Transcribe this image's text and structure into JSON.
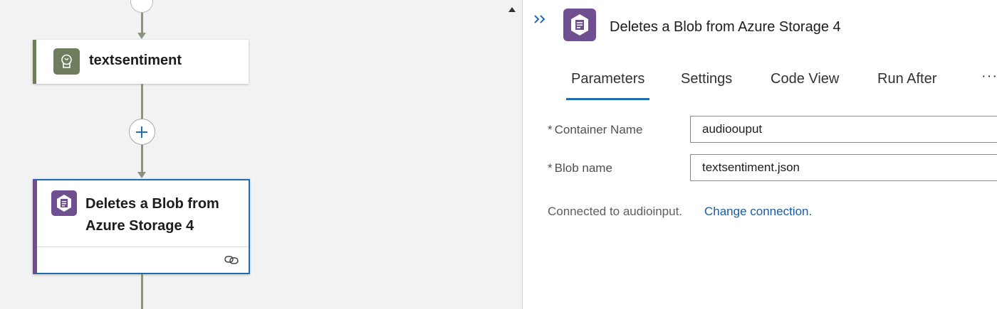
{
  "canvas": {
    "nodes": [
      {
        "title": "textsentiment",
        "icon": "brain-icon",
        "accent": "#6f7d5f"
      },
      {
        "title": "Deletes a Blob from Azure Storage 4",
        "icon": "blob-storage-icon",
        "accent": "#6f4f8f"
      }
    ],
    "add_step_icon": "plus-icon",
    "node_footer_icon": "link-icon"
  },
  "panel": {
    "title": "Deletes a Blob from Azure Storage 4",
    "collapse_icon": "chevrons-right-icon",
    "tabs": [
      {
        "label": "Parameters",
        "active": true
      },
      {
        "label": "Settings",
        "active": false
      },
      {
        "label": "Code View",
        "active": false
      },
      {
        "label": "Run After",
        "active": false
      }
    ],
    "more_label": "···",
    "fields": [
      {
        "label": "Container Name",
        "required_mark": "*",
        "value": "audioouput"
      },
      {
        "label": "Blob name",
        "required_mark": "*",
        "value": "textsentiment.json"
      }
    ],
    "connection_text": "Connected to audioinput.",
    "change_connection_label": "Change connection."
  },
  "colors": {
    "accent_blue": "#1f6bb4",
    "storage_purple": "#6f4f8f",
    "ai_green": "#6f7d5f"
  }
}
